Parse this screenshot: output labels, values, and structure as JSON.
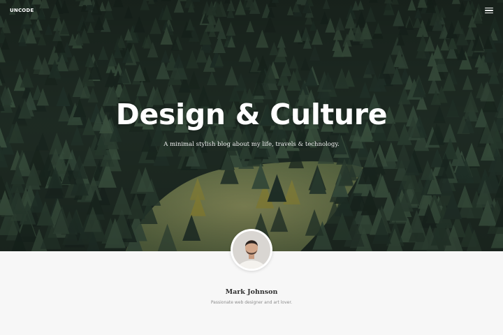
{
  "brand": {
    "logo_text": "UNCODE"
  },
  "nav": {
    "menu_icon": "hamburger-menu-icon"
  },
  "hero": {
    "title": "Design & Culture",
    "subtitle": "A minimal stylish blog about my life, travels & technology.",
    "background": "aerial-pine-forest-photo"
  },
  "author": {
    "avatar": "author-portrait-photo",
    "name": "Mark Johnson",
    "bio": "Passionate web designer and art lover."
  },
  "colors": {
    "forest_dark": "#1c2a22",
    "forest_mid": "#2f4433",
    "meadow": "#7d8452",
    "autumn_tree": "#a8953f",
    "background_light": "#f7f7f7",
    "name_text": "#303030",
    "bio_text": "#8c8c8c"
  }
}
